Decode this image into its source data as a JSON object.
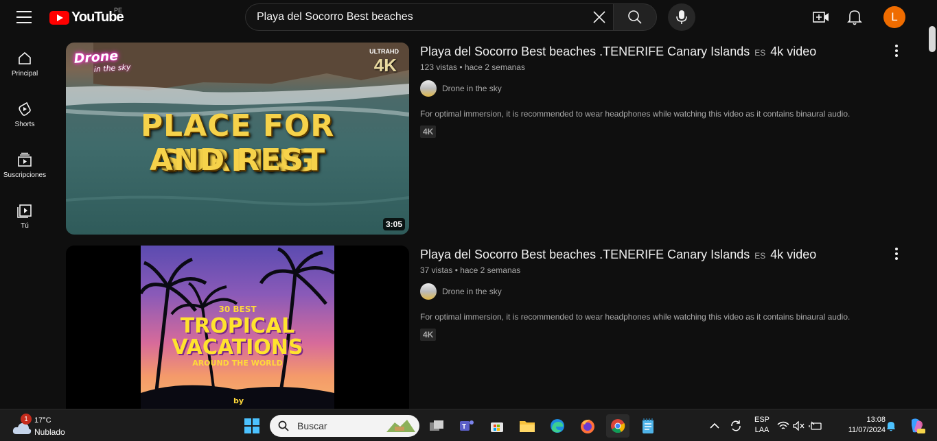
{
  "header": {
    "logo_text": "YouTube",
    "country": "PE",
    "search_value": "Playa del Socorro Best beaches",
    "avatar_letter": "L",
    "colors": {
      "brand_red": "#ff0000",
      "avatar": "#ef6c00",
      "background": "#0f0f0f"
    }
  },
  "sidebar": {
    "items": [
      {
        "label": "Principal",
        "icon": "home-icon"
      },
      {
        "label": "Shorts",
        "icon": "shorts-icon"
      },
      {
        "label": "Suscripciones",
        "icon": "subscriptions-icon"
      },
      {
        "label": "Tú",
        "icon": "you-icon"
      }
    ]
  },
  "results": [
    {
      "title_main": "Playa del Socorro Best beaches .TENERIFE Canary Islands",
      "title_flag": "ES",
      "title_end": "4k video",
      "views": "123 vistas",
      "age": "hace 2 semanas",
      "channel": "Drone in the sky",
      "description": "For optimal immersion, it is recommended to wear headphones while watching this video as it contains binaural audio.",
      "badge": "4K",
      "duration": "3:05",
      "thumb": {
        "logo_line1": "Drone",
        "logo_line2": "in the sky",
        "quality1": "ULTRAHD",
        "quality2": "4K",
        "headline1": "PLACE FOR SURFING",
        "headline2": "AND REST"
      }
    },
    {
      "title_main": "Playa del Socorro Best beaches .TENERIFE Canary Islands",
      "title_flag": "ES",
      "title_end": "4k video",
      "views": "37 vistas",
      "age": "hace 2 semanas",
      "channel": "Drone in the sky",
      "description": "For optimal immersion, it is recommended to wear headphones while watching this video as it contains binaural audio.",
      "badge": "4K",
      "thumb": {
        "line1": "30 BEST",
        "line2": "TROPICAL",
        "line3": "VACATIONS",
        "line4": "AROUND THE WORLD",
        "line5": "by"
      }
    }
  ],
  "taskbar": {
    "weather_badge": "1",
    "temperature": "17°C",
    "condition": "Nublado",
    "search_placeholder": "Buscar",
    "lang1": "ESP",
    "lang2": "LAA",
    "time": "13:08",
    "date": "11/07/2024"
  }
}
